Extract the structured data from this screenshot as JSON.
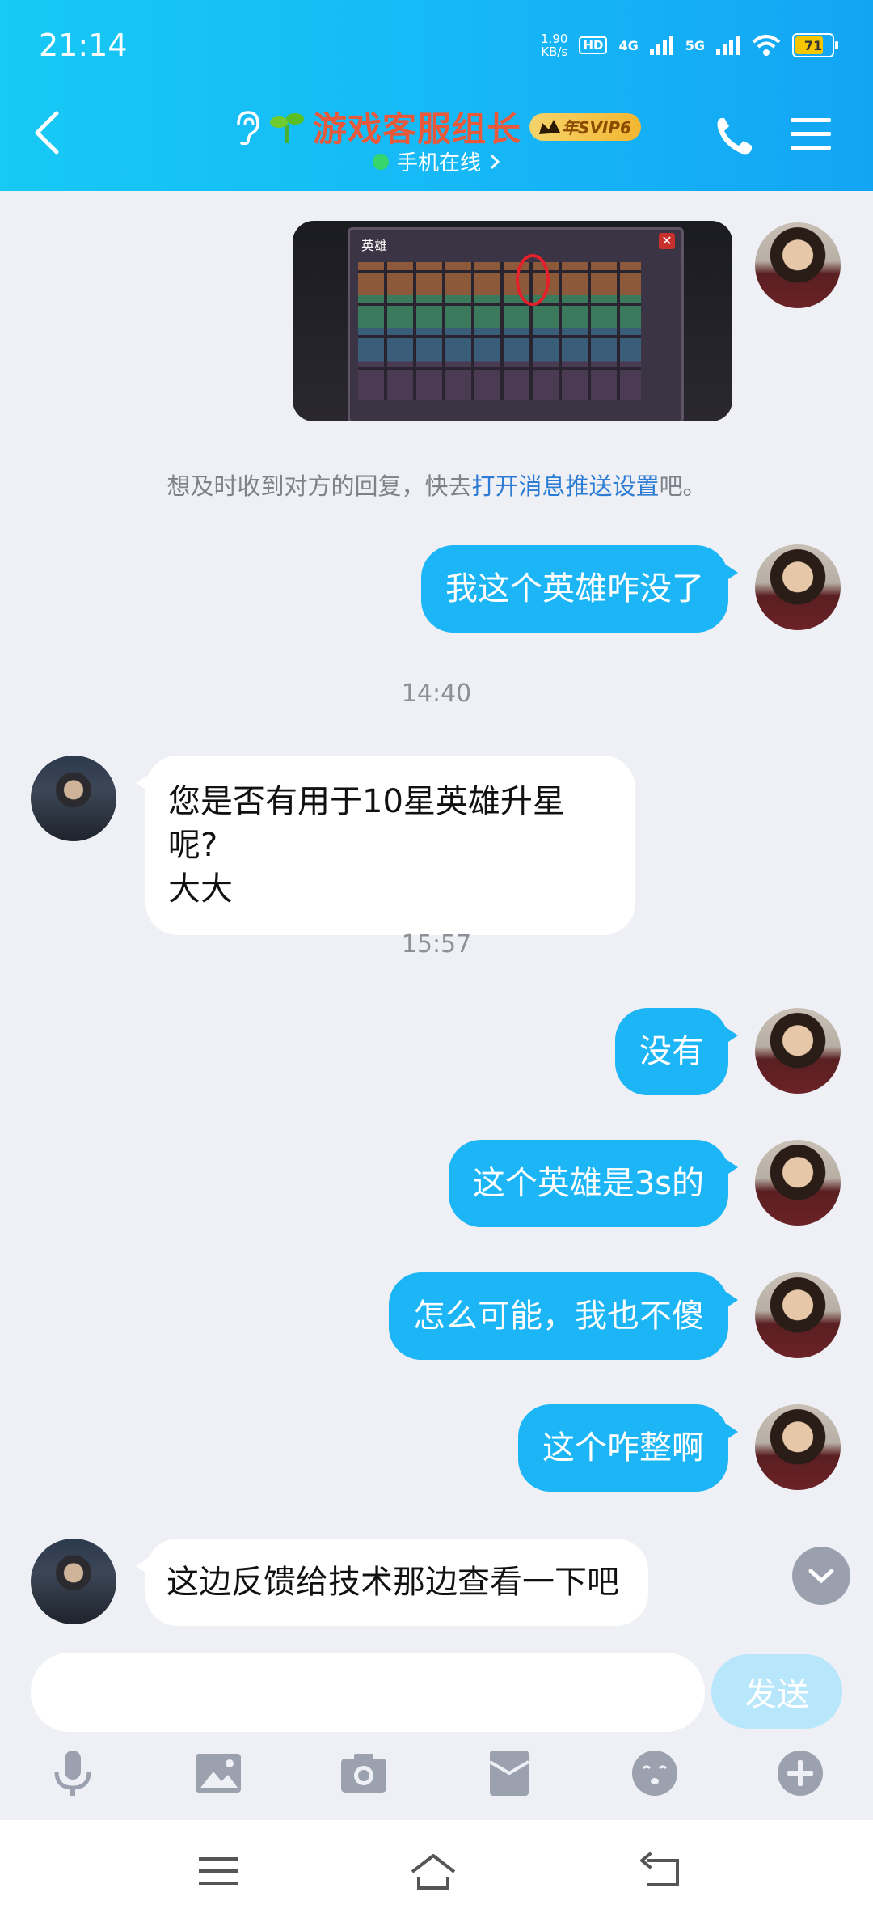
{
  "status_bar": {
    "time": "21:14",
    "net_speed_value": "1.90",
    "net_speed_unit": "KB/s",
    "hd_badge": "HD",
    "sim_label_1": "4G",
    "sim_label_2": "5G",
    "battery_level": "71"
  },
  "header": {
    "title": "游戏客服组长",
    "vip_badge": "年SVIP6",
    "status_text": "手机在线",
    "colors": {
      "gradient_start": "#17C9F5",
      "gradient_end": "#13A5F4",
      "title": "#E8593C"
    }
  },
  "messages": {
    "hint_prefix": "想及时收到对方的回复，快去",
    "hint_link": "打开消息推送设置",
    "hint_suffix": "吧。",
    "time_1": "14:40",
    "time_2": "15:57",
    "m1": "我这个英雄咋没了",
    "m2_line1": "您是否有用于10星英雄升星呢?",
    "m2_line2": "大大",
    "m3": "没有",
    "m4": "这个英雄是3s的",
    "m5": "怎么可能，我也不傻",
    "m6": "这个咋整啊",
    "m7": "这边反馈给技术那边查看一下吧"
  },
  "game_screenshot": {
    "title": "英雄",
    "close": "✕"
  },
  "composer": {
    "input_placeholder": "",
    "send_label": "发送"
  },
  "icons": {
    "back": "chevron-left-icon",
    "ear": "ear-icon",
    "call": "phone-icon",
    "menu": "hamburger-icon",
    "voice": "microphone-icon",
    "image": "image-icon",
    "camera": "camera-icon",
    "red_packet": "red-packet-icon",
    "emoji": "emoji-icon",
    "plus": "plus-icon"
  }
}
